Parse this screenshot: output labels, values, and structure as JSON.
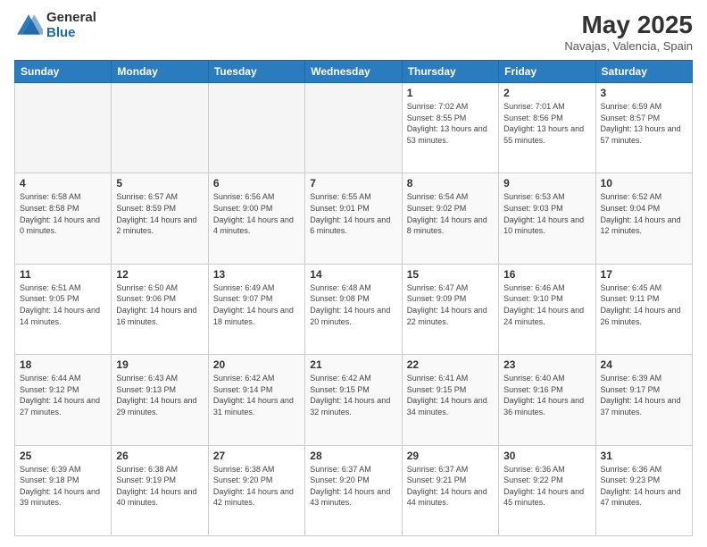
{
  "logo": {
    "general": "General",
    "blue": "Blue"
  },
  "title": "May 2025",
  "subtitle": "Navajas, Valencia, Spain",
  "days_of_week": [
    "Sunday",
    "Monday",
    "Tuesday",
    "Wednesday",
    "Thursday",
    "Friday",
    "Saturday"
  ],
  "weeks": [
    [
      {
        "day": "",
        "info": ""
      },
      {
        "day": "",
        "info": ""
      },
      {
        "day": "",
        "info": ""
      },
      {
        "day": "",
        "info": ""
      },
      {
        "day": "1",
        "info": "Sunrise: 7:02 AM\nSunset: 8:55 PM\nDaylight: 13 hours and 53 minutes."
      },
      {
        "day": "2",
        "info": "Sunrise: 7:01 AM\nSunset: 8:56 PM\nDaylight: 13 hours and 55 minutes."
      },
      {
        "day": "3",
        "info": "Sunrise: 6:59 AM\nSunset: 8:57 PM\nDaylight: 13 hours and 57 minutes."
      }
    ],
    [
      {
        "day": "4",
        "info": "Sunrise: 6:58 AM\nSunset: 8:58 PM\nDaylight: 14 hours and 0 minutes."
      },
      {
        "day": "5",
        "info": "Sunrise: 6:57 AM\nSunset: 8:59 PM\nDaylight: 14 hours and 2 minutes."
      },
      {
        "day": "6",
        "info": "Sunrise: 6:56 AM\nSunset: 9:00 PM\nDaylight: 14 hours and 4 minutes."
      },
      {
        "day": "7",
        "info": "Sunrise: 6:55 AM\nSunset: 9:01 PM\nDaylight: 14 hours and 6 minutes."
      },
      {
        "day": "8",
        "info": "Sunrise: 6:54 AM\nSunset: 9:02 PM\nDaylight: 14 hours and 8 minutes."
      },
      {
        "day": "9",
        "info": "Sunrise: 6:53 AM\nSunset: 9:03 PM\nDaylight: 14 hours and 10 minutes."
      },
      {
        "day": "10",
        "info": "Sunrise: 6:52 AM\nSunset: 9:04 PM\nDaylight: 14 hours and 12 minutes."
      }
    ],
    [
      {
        "day": "11",
        "info": "Sunrise: 6:51 AM\nSunset: 9:05 PM\nDaylight: 14 hours and 14 minutes."
      },
      {
        "day": "12",
        "info": "Sunrise: 6:50 AM\nSunset: 9:06 PM\nDaylight: 14 hours and 16 minutes."
      },
      {
        "day": "13",
        "info": "Sunrise: 6:49 AM\nSunset: 9:07 PM\nDaylight: 14 hours and 18 minutes."
      },
      {
        "day": "14",
        "info": "Sunrise: 6:48 AM\nSunset: 9:08 PM\nDaylight: 14 hours and 20 minutes."
      },
      {
        "day": "15",
        "info": "Sunrise: 6:47 AM\nSunset: 9:09 PM\nDaylight: 14 hours and 22 minutes."
      },
      {
        "day": "16",
        "info": "Sunrise: 6:46 AM\nSunset: 9:10 PM\nDaylight: 14 hours and 24 minutes."
      },
      {
        "day": "17",
        "info": "Sunrise: 6:45 AM\nSunset: 9:11 PM\nDaylight: 14 hours and 26 minutes."
      }
    ],
    [
      {
        "day": "18",
        "info": "Sunrise: 6:44 AM\nSunset: 9:12 PM\nDaylight: 14 hours and 27 minutes."
      },
      {
        "day": "19",
        "info": "Sunrise: 6:43 AM\nSunset: 9:13 PM\nDaylight: 14 hours and 29 minutes."
      },
      {
        "day": "20",
        "info": "Sunrise: 6:42 AM\nSunset: 9:14 PM\nDaylight: 14 hours and 31 minutes."
      },
      {
        "day": "21",
        "info": "Sunrise: 6:42 AM\nSunset: 9:15 PM\nDaylight: 14 hours and 32 minutes."
      },
      {
        "day": "22",
        "info": "Sunrise: 6:41 AM\nSunset: 9:15 PM\nDaylight: 14 hours and 34 minutes."
      },
      {
        "day": "23",
        "info": "Sunrise: 6:40 AM\nSunset: 9:16 PM\nDaylight: 14 hours and 36 minutes."
      },
      {
        "day": "24",
        "info": "Sunrise: 6:39 AM\nSunset: 9:17 PM\nDaylight: 14 hours and 37 minutes."
      }
    ],
    [
      {
        "day": "25",
        "info": "Sunrise: 6:39 AM\nSunset: 9:18 PM\nDaylight: 14 hours and 39 minutes."
      },
      {
        "day": "26",
        "info": "Sunrise: 6:38 AM\nSunset: 9:19 PM\nDaylight: 14 hours and 40 minutes."
      },
      {
        "day": "27",
        "info": "Sunrise: 6:38 AM\nSunset: 9:20 PM\nDaylight: 14 hours and 42 minutes."
      },
      {
        "day": "28",
        "info": "Sunrise: 6:37 AM\nSunset: 9:20 PM\nDaylight: 14 hours and 43 minutes."
      },
      {
        "day": "29",
        "info": "Sunrise: 6:37 AM\nSunset: 9:21 PM\nDaylight: 14 hours and 44 minutes."
      },
      {
        "day": "30",
        "info": "Sunrise: 6:36 AM\nSunset: 9:22 PM\nDaylight: 14 hours and 45 minutes."
      },
      {
        "day": "31",
        "info": "Sunrise: 6:36 AM\nSunset: 9:23 PM\nDaylight: 14 hours and 47 minutes."
      }
    ]
  ]
}
